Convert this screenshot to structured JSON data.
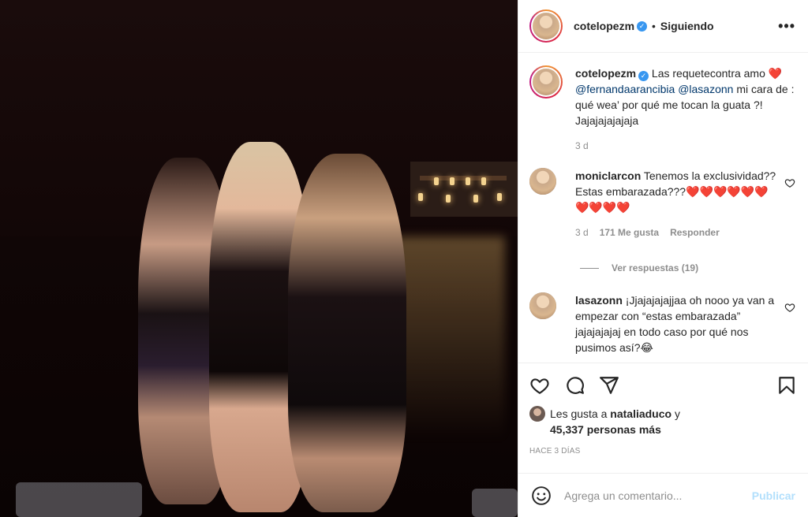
{
  "post": {
    "username": "cotelopezm",
    "follow_label": "Siguiendo",
    "more_label": "•••",
    "caption": {
      "username": "cotelopezm",
      "text_1": "Las requetecontra amo",
      "heart": "❤️",
      "mention_1": "@fernandaarancibia",
      "mention_2": "@lasazonn",
      "text_2": "mi cara de : qué wea’ por qué me tocan la guata ?! Jajajajajajaja",
      "time": "3 d"
    },
    "comments": [
      {
        "username": "moniclarcon",
        "text": "Tenemos la exclusividad?? Estas embarazada???",
        "hearts": "❤️❤️❤️❤️❤️❤️❤️❤️❤️❤️",
        "time": "3 d",
        "likes": "171 Me gusta",
        "reply": "Responder",
        "view_replies": "Ver respuestas (19)"
      },
      {
        "username": "lasazonn",
        "text": "¡Jjajajajajjaa oh nooo ya van a empezar con “estas embarazada” jajajajajaj en todo caso por qué nos pusimos así?😂"
      }
    ],
    "likes": {
      "prefix": "Les gusta a",
      "user": "nataliaduco",
      "and": "y",
      "count": "45,337 personas más"
    },
    "posted": "HACE 3 DÍAS",
    "add_comment_placeholder": "Agrega un comentario...",
    "publish_label": "Publicar"
  },
  "icons": {
    "verified": "verified-badge",
    "heart": "heart-icon",
    "comment": "comment-icon",
    "share": "share-icon",
    "save": "bookmark-icon",
    "emoji": "emoji-icon"
  },
  "colors": {
    "link": "#00376b",
    "muted": "#8e8e8e",
    "verified": "#3897f0",
    "publish_disabled": "#b2dffc"
  }
}
